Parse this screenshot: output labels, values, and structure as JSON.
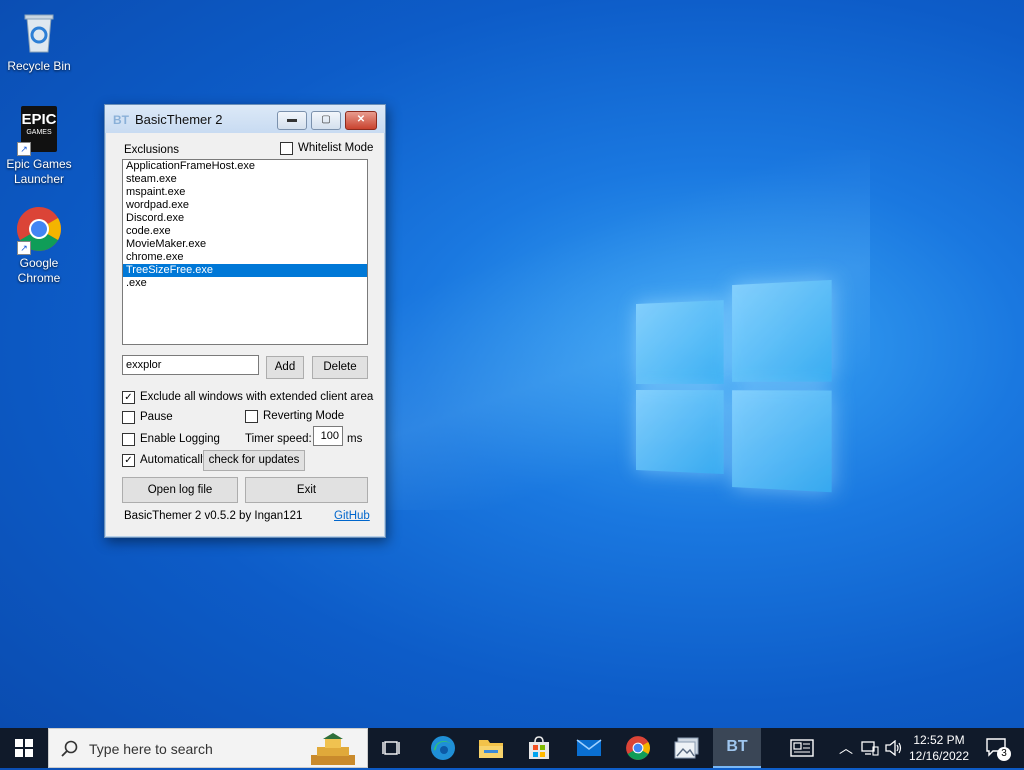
{
  "desktop": {
    "icons": [
      {
        "label": "Recycle Bin"
      },
      {
        "label": "Epic Games Launcher"
      },
      {
        "label": "Google Chrome"
      }
    ],
    "epic_logo_text": "EPIC",
    "epic_logo_subtext": "GAMES"
  },
  "window": {
    "title": "BasicThemer 2",
    "icon_text": "BT",
    "exclusions_label": "Exclusions",
    "whitelist_label": "Whitelist Mode",
    "whitelist_checked": false,
    "exclusions": [
      "ApplicationFrameHost.exe",
      "steam.exe",
      "mspaint.exe",
      "wordpad.exe",
      "Discord.exe",
      "code.exe",
      "MovieMaker.exe",
      "chrome.exe",
      "TreeSizeFree.exe",
      ".exe"
    ],
    "selected_index": 8,
    "input_value": "exxplor",
    "add_label": "Add",
    "delete_label": "Delete",
    "exclude_extended_label": "Exclude all windows with extended client area",
    "pause_label": "Pause",
    "reverting_label": "Reverting Mode",
    "logging_label": "Enable Logging",
    "timer_label": "Timer speed:",
    "timer_value": "100",
    "timer_unit": "ms",
    "auto_label": "Automatically",
    "check_updates_label": "check for updates",
    "open_log_label": "Open log file",
    "exit_label": "Exit",
    "version_text": "BasicThemer 2 v0.5.2 by Ingan121",
    "github_label": "GitHub"
  },
  "taskbar": {
    "search_placeholder": "Type here to search",
    "bt_label": "BT",
    "time": "12:52 PM",
    "date": "12/16/2022",
    "notification_count": "3"
  }
}
